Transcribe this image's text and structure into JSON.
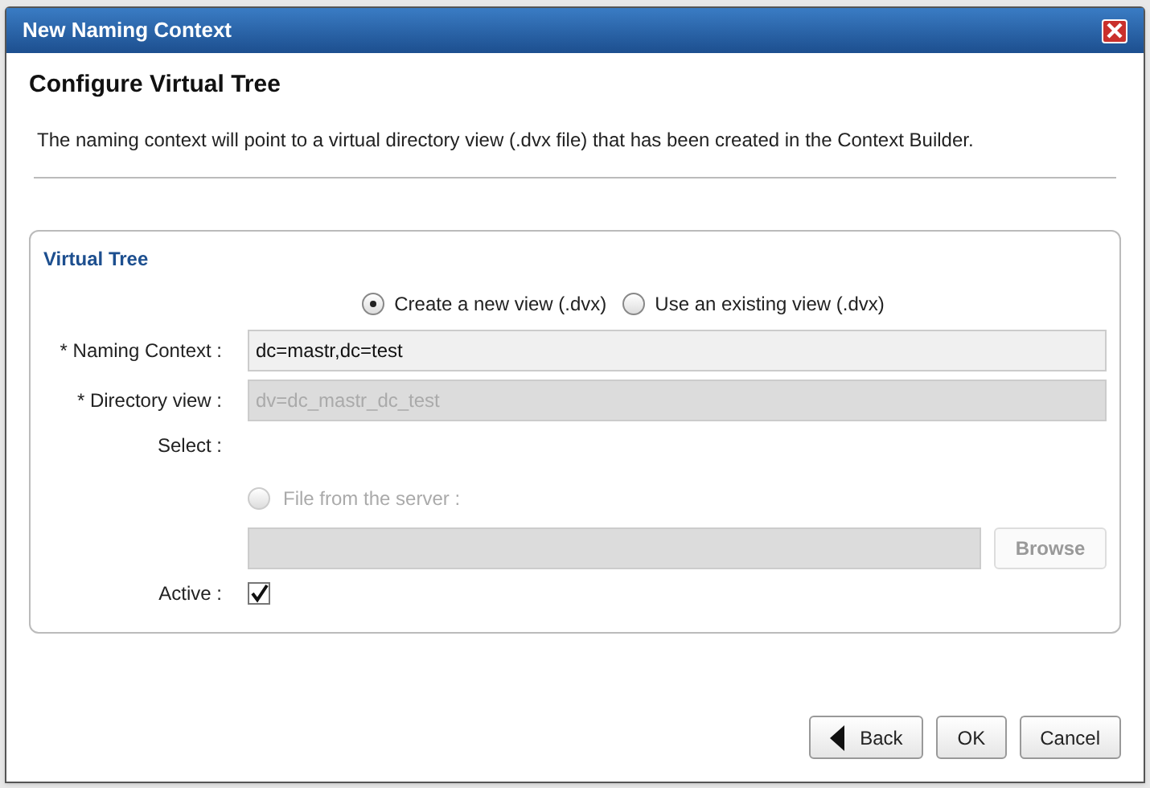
{
  "window": {
    "title": "New Naming Context"
  },
  "heading": "Configure Virtual Tree",
  "description": "The naming context will point to a virtual directory view (.dvx file) that has been created in the Context Builder.",
  "panel": {
    "title": "Virtual Tree",
    "view_options": [
      {
        "label": "Create a new view (.dvx)",
        "selected": true
      },
      {
        "label": "Use an existing view (.dvx)",
        "selected": false
      }
    ],
    "naming_context": {
      "label": "* Naming Context :",
      "value": "dc=mastr,dc=test",
      "disabled": false
    },
    "directory_view": {
      "label": "* Directory view :",
      "value": "dv=dc_mastr_dc_test",
      "disabled": true
    },
    "select": {
      "label": "Select :",
      "option": {
        "label": "File from the server :",
        "selected": false,
        "disabled": true
      },
      "file_field": {
        "disabled": true
      },
      "browse": {
        "label": "Browse",
        "disabled": true
      }
    },
    "active": {
      "label": "Active :",
      "checked": true
    }
  },
  "buttons": [
    {
      "label": "Back",
      "kind": "back"
    },
    {
      "label": "OK",
      "kind": "plain"
    },
    {
      "label": "Cancel",
      "kind": "plain"
    }
  ]
}
